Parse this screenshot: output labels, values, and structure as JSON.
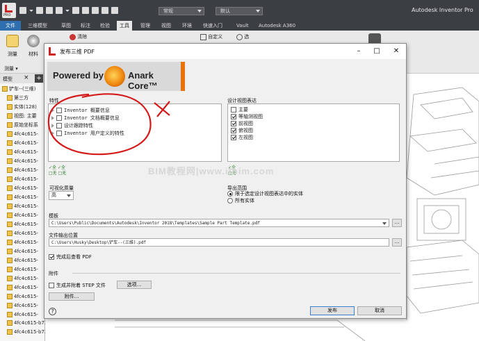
{
  "app": {
    "title": "Autodesk Inventor Pro",
    "pro_badge": "PRO",
    "style_combo": "常规",
    "appearance_combo": "默认"
  },
  "ribbon_tabs": [
    "文件",
    "三维模型",
    "草图",
    "标注",
    "检验",
    "工具",
    "管理",
    "视图",
    "环境",
    "快速入门",
    "Vault",
    "Autodesk A360"
  ],
  "ribbon": {
    "tool_measure": "测量",
    "tool_material": "材料",
    "tool_clear": "清除",
    "tool_custom": "自定义",
    "tool_options": "选",
    "group_measure": "测量"
  },
  "browser": {
    "tab_label": "模型",
    "root": "铲车--(三维)",
    "items": [
      "第三方",
      "实体(128)",
      "视图: 主要",
      "原始坐标系"
    ],
    "part_rows": [
      "4fc4c615-",
      "4fc4c615-",
      "4fc4c615-",
      "4fc4c615-",
      "4fc4c615-",
      "4fc4c615-",
      "4fc4c615-",
      "4fc4c615-",
      "4fc4c615-",
      "4fc4c615-",
      "4fc4c615-",
      "4fc4c615-",
      "4fc4c615-",
      "4fc4c615-",
      "4fc4c615-",
      "4fc4c615-",
      "4fc4c615-",
      "4fc4c615-",
      "4fc4c615-",
      "4fc4c615-",
      "4fc4c615-"
    ],
    "bottom_rows": [
      "4fc4c615-b729-4cec-aa0e-ac971115f8",
      "4fc4c615-b729-4cec-aa0e-ac971115f8"
    ]
  },
  "dialog": {
    "title": "发布三维 PDF",
    "banner_powered": "Powered by",
    "banner_core": "Anark Core™",
    "properties_label": "特性",
    "properties": [
      "Inventor 概要信息",
      "Inventor 文档概要信息",
      "设计跟踪特性",
      "Inventor 用户定义的特性"
    ],
    "design_views_label": "设计视图表达",
    "design_views": [
      {
        "label": "主要",
        "checked": false
      },
      {
        "label": "等轴测视图",
        "checked": true
      },
      {
        "label": "前视图",
        "checked": true
      },
      {
        "label": "俯视图",
        "checked": true
      },
      {
        "label": "左视图",
        "checked": true
      }
    ],
    "mini_icons_left": [
      "✓全",
      "✓全",
      "□无",
      "□无"
    ],
    "mini_icons_right": [
      "✓全",
      "□无"
    ],
    "quality_label": "可视化质量",
    "quality_value": "高",
    "export_scope_label": "导出范围",
    "export_scope_options": [
      {
        "label": "限于选定设计视图表达中的实体",
        "selected": true
      },
      {
        "label": "所有实体",
        "selected": false
      }
    ],
    "template_label": "模板",
    "template_path": "C:\\Users\\Public\\Documents\\Autodesk\\Inventor 2018\\Templates\\Sample Part Template.pdf",
    "output_label": "文件输出位置",
    "output_path": "C:\\Users\\Husky\\Desktop\\铲车--(三维).pdf",
    "browse_label": "...",
    "view_after_label": "完成后查看 PDF",
    "attachments_label": "附件",
    "gen_step_label": "生成并附着 STEP 文件",
    "options_button": "选项...",
    "attach_button": "附件...",
    "publish_button": "发布",
    "cancel_button": "取消"
  },
  "watermark": "BIM教程网|www.ifbim.com",
  "colors": {
    "ribbon_dark": "#3b3f44",
    "file_tab": "#2f6fb0",
    "banner_orange": "#e8720c",
    "annotation_red": "#d41a1a"
  }
}
